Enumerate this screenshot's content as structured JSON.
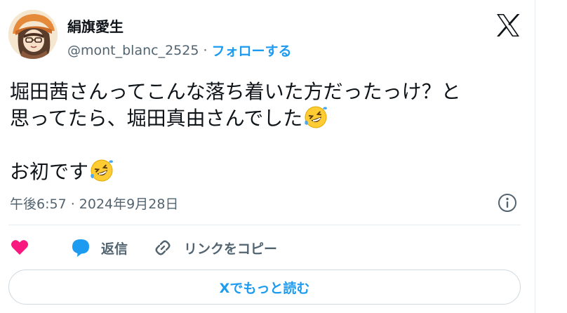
{
  "tweet": {
    "author_name": "絹旗愛生",
    "handle": "@mont_blanc_2525",
    "separator": "·",
    "follow_label": "フォローする",
    "text_line1": "堀田茜さんってこんな落ち着いた方だったっけ？と",
    "text_line2": "思ってたら、堀田真由さんでした",
    "text_line3": "お初です",
    "timestamp": "午後6:57 · 2024年9月28日"
  },
  "actions": {
    "reply_label": "返信",
    "copy_link_label": "リンクをコピー"
  },
  "read_more_label": "Xでもっと読む",
  "icons": {
    "like": "heart-icon",
    "reply": "speech-bubble-icon",
    "copy": "link-icon",
    "info": "info-icon",
    "logo": "x-logo-icon",
    "emoji": "rolling-on-floor-laughing-emoji"
  },
  "colors": {
    "accent": "#1d9bf0",
    "like": "#f91880",
    "text": "#0f1419",
    "muted": "#536471",
    "border": "#cfd9de"
  }
}
